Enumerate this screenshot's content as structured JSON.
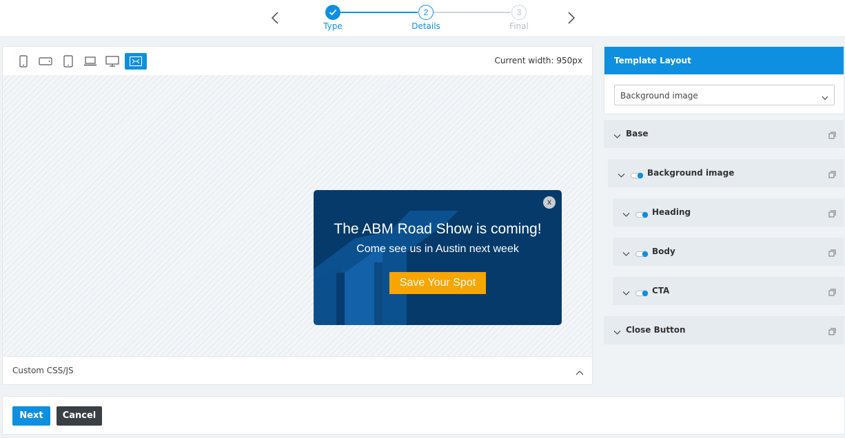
{
  "stepper": {
    "steps": [
      {
        "number": "",
        "label": "Type",
        "state": "done"
      },
      {
        "number": "2",
        "label": "Details",
        "state": "active"
      },
      {
        "number": "3",
        "label": "Final",
        "state": "upcoming"
      }
    ],
    "prev_icon": "chevron-left-icon",
    "next_icon": "chevron-right-icon"
  },
  "preview": {
    "device_buttons": [
      {
        "icon": "mobile-portrait-icon"
      },
      {
        "icon": "mobile-landscape-icon"
      },
      {
        "icon": "tablet-icon"
      },
      {
        "icon": "laptop-icon"
      },
      {
        "icon": "desktop-icon"
      },
      {
        "icon": "fullscreen-icon",
        "active": true
      }
    ],
    "current_width": "Current width: 950px",
    "custom_css_label": "Custom CSS/JS"
  },
  "popup": {
    "close_label": "x",
    "heading": "The ABM Road Show is coming!",
    "body": "Come see us in Austin next week",
    "cta": "Save Your Spot"
  },
  "template_layout": {
    "title": "Template Layout",
    "selected": "Background image"
  },
  "sections": [
    {
      "label": "Base",
      "toggle": false
    },
    {
      "label": "Background image",
      "toggle": true
    },
    {
      "label": "Heading",
      "toggle": true
    },
    {
      "label": "Body",
      "toggle": true
    },
    {
      "label": "CTA",
      "toggle": true
    },
    {
      "label": "Close Button",
      "toggle": false
    }
  ],
  "actions": {
    "next": "Next",
    "cancel": "Cancel"
  },
  "colors": {
    "accent": "#0f8fe0",
    "popup_bg": "#063a6a",
    "cta_bg": "#f7a600"
  }
}
